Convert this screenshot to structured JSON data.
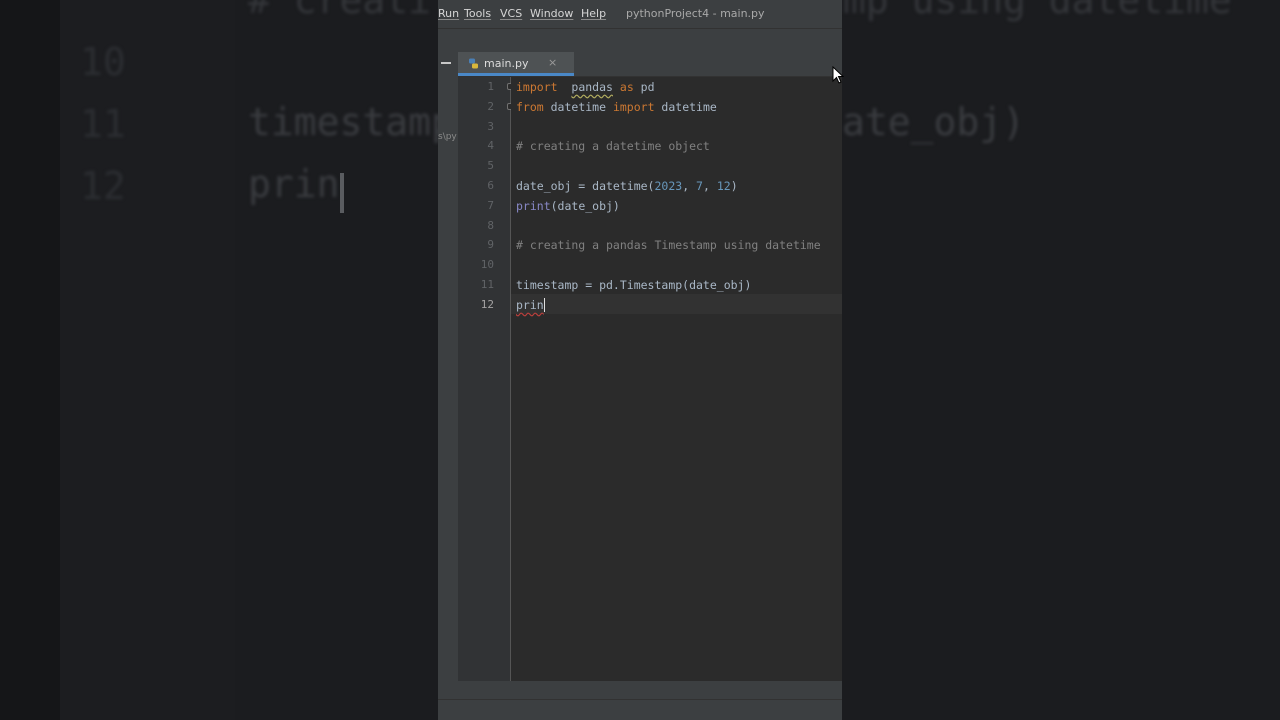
{
  "background": {
    "line_numbers": [
      "10",
      "11",
      "12"
    ],
    "top_line_fragment": "# creati",
    "top_line_fragment_right": "amp using datetime",
    "line11_left": "timestamp",
    "line11_right": "ate_obj)",
    "line12": "prin"
  },
  "menubar": {
    "items": [
      {
        "label": "Run"
      },
      {
        "label": "Tools"
      },
      {
        "label": "VCS"
      },
      {
        "label": "Window"
      },
      {
        "label": "Help"
      }
    ],
    "window_title": "pythonProject4 - main.py"
  },
  "project_panel": {
    "path_fragment": "s\\py"
  },
  "tabs": [
    {
      "label": "main.py",
      "close": "×",
      "active": true
    }
  ],
  "editor": {
    "current_line": 12,
    "lines": [
      {
        "n": "1",
        "tokens": [
          {
            "t": "import",
            "c": "kw"
          },
          {
            "t": "  "
          },
          {
            "t": "pandas",
            "c": "squiggle"
          },
          {
            "t": " "
          },
          {
            "t": "as",
            "c": "kw"
          },
          {
            "t": " pd"
          }
        ]
      },
      {
        "n": "2",
        "tokens": [
          {
            "t": "from",
            "c": "kw"
          },
          {
            "t": " datetime "
          },
          {
            "t": "import",
            "c": "kw"
          },
          {
            "t": " datetime"
          }
        ]
      },
      {
        "n": "3",
        "tokens": []
      },
      {
        "n": "4",
        "tokens": [
          {
            "t": "# creating a datetime object",
            "c": "cm"
          }
        ]
      },
      {
        "n": "5",
        "tokens": []
      },
      {
        "n": "6",
        "tokens": [
          {
            "t": "date_obj = datetime("
          },
          {
            "t": "2023",
            "c": "num"
          },
          {
            "t": ", "
          },
          {
            "t": "7",
            "c": "num"
          },
          {
            "t": ", "
          },
          {
            "t": "12",
            "c": "num"
          },
          {
            "t": ")"
          }
        ]
      },
      {
        "n": "7",
        "tokens": [
          {
            "t": "print",
            "c": "bi"
          },
          {
            "t": "(date_obj)"
          }
        ]
      },
      {
        "n": "8",
        "tokens": []
      },
      {
        "n": "9",
        "tokens": [
          {
            "t": "# creating a pandas Timestamp using datetime",
            "c": "cm"
          }
        ]
      },
      {
        "n": "10",
        "tokens": []
      },
      {
        "n": "11",
        "tokens": [
          {
            "t": "timestamp = pd.Timestamp(date_obj)"
          }
        ]
      },
      {
        "n": "12",
        "tokens": [
          {
            "t": "prin",
            "c": "err"
          }
        ]
      }
    ]
  },
  "colors": {
    "keyword": "#cc7832",
    "comment": "#808080",
    "number": "#6897bb",
    "builtin": "#8888c6",
    "text": "#a9b7c6",
    "accent": "#4a88c7"
  }
}
